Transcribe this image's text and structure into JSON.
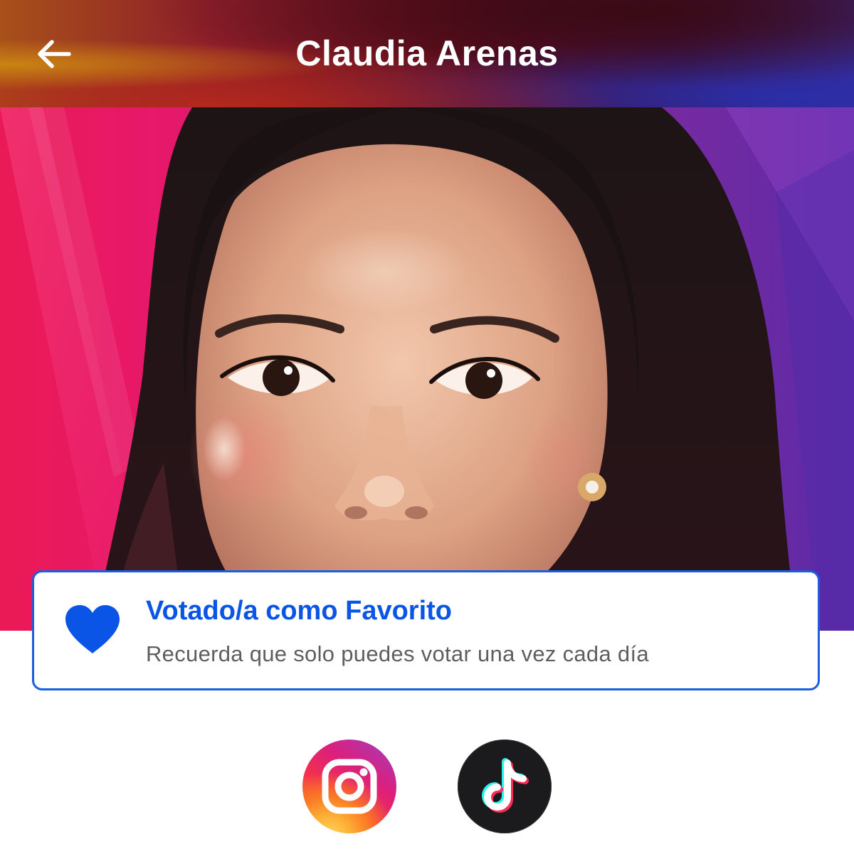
{
  "header": {
    "title": "Claudia Arenas",
    "back_icon": "arrow-left-icon"
  },
  "hero": {
    "image": "contestant-portrait"
  },
  "vote_card": {
    "icon": "heart-icon",
    "title": "Votado/a como Favorito",
    "subtitle": "Recuerda que solo puedes votar una vez cada día",
    "accent_color": "#0b55e6"
  },
  "social": {
    "items": [
      {
        "icon": "instagram-icon"
      },
      {
        "icon": "tiktok-icon"
      }
    ]
  }
}
